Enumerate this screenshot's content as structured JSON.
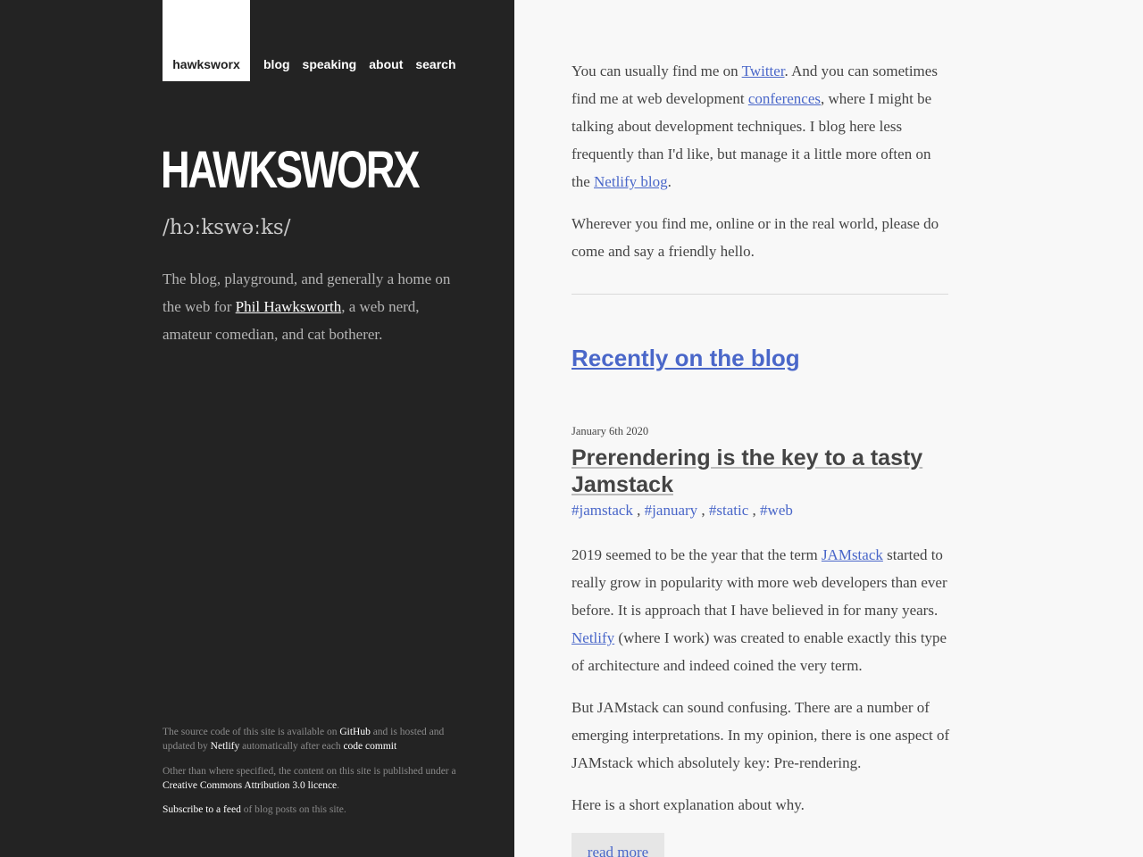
{
  "nav": {
    "logo": "hawksworx",
    "links": [
      "blog",
      "speaking",
      "about",
      "search"
    ]
  },
  "sidebar": {
    "brand": "HAWKSWORX",
    "pronunciation": "/hɔːkswəːks/",
    "intro_before": "The blog, playground, and generally a home on the web for ",
    "intro_link": "Phil Hawksworth",
    "intro_after": ", a web nerd, amateur comedian, and cat botherer.",
    "footer": {
      "f1_a": "The source code of this site is available on ",
      "f1_github": "GitHub",
      "f1_b": " and is hosted and updated by ",
      "f1_netlify": "Netlify",
      "f1_c": " automatically after each ",
      "f1_commit": "code commit",
      "f2_a": "Other than where specified, the content on this site is published under a ",
      "f2_licence": "Creative Commons Attribution 3.0 licence",
      "f2_b": ".",
      "f3_link": "Subscribe to a feed",
      "f3_b": " of blog posts on this site."
    }
  },
  "main": {
    "p1_a": "You can usually find me on ",
    "p1_twitter": "Twitter",
    "p1_b": ". And you can sometimes find me at web development ",
    "p1_conferences": "conferences",
    "p1_c": ", where I might be talking about development techniques. I blog here less frequently than I'd like, but manage it a little more often on the ",
    "p1_netlify_blog": "Netlify blog",
    "p1_d": ".",
    "p2": "Wherever you find me, online or in the real world, please do come and say a friendly hello.",
    "recent_heading": "Recently on the blog",
    "post": {
      "date": "January 6th 2020",
      "title": "Prerendering is the key to a tasty Jamstack",
      "tags": [
        "#jamstack",
        "#january",
        "#static",
        "#web"
      ],
      "tag_sep": " , ",
      "p3_a": "2019 seemed to be the year that the term ",
      "p3_jamstack": "JAMstack",
      "p3_b": " started to really grow in popularity with more web developers than ever before. It is approach that I have believed in for many years. ",
      "p3_netlify": "Netlify",
      "p3_c": " (where I work) was created to enable exactly this type of architecture and indeed coined the very term.",
      "p4": "But JAMstack can sound confusing. There are a number of emerging interpretations. In my opinion, there is one aspect of JAMstack which absolutely key: Pre-rendering.",
      "p5": "Here is a short explanation about why.",
      "read_more": "read more"
    }
  },
  "colors": {
    "sidebar_bg": "#232323",
    "content_bg": "#f8f8f8",
    "link": "#4a67c9"
  }
}
